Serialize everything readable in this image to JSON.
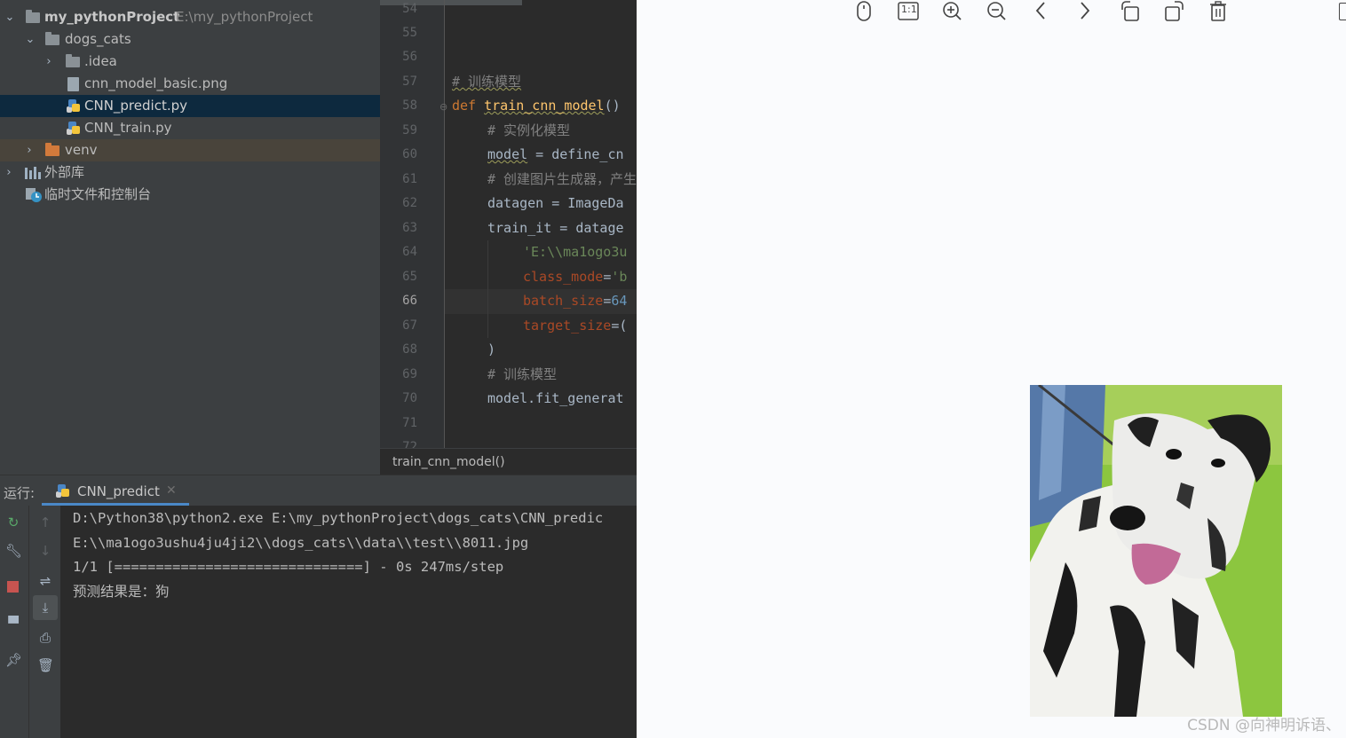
{
  "project": {
    "root_name": "my_pythonProject",
    "root_path": "E:\\my_pythonProject",
    "items": [
      {
        "label": "dogs_cats"
      },
      {
        "label": ".idea"
      },
      {
        "label": "cnn_model_basic.png"
      },
      {
        "label": "CNN_predict.py"
      },
      {
        "label": "CNN_train.py"
      },
      {
        "label": "venv"
      }
    ],
    "external_libs": "外部库",
    "scratches": "临时文件和控制台"
  },
  "editor": {
    "line_numbers": [
      "54",
      "55",
      "56",
      "57",
      "58",
      "59",
      "60",
      "61",
      "62",
      "63",
      "64",
      "65",
      "66",
      "67",
      "68",
      "69",
      "70",
      "71",
      "72"
    ],
    "current_line": "66",
    "code": {
      "l57": "# 训练模型",
      "l58_kw": "def",
      "l58_fn": "train_cnn_model",
      "l58_tail": "()",
      "l59": "# 实例化模型",
      "l60_var": "model",
      "l60_rest": " = define_cn",
      "l61": "# 创建图片生成器，产生",
      "l62": "datagen = ImageDa",
      "l63": "train_it = datage",
      "l64": "'E:\\\\ma1ogo3u",
      "l65_p": "class_mode",
      "l65_s": "'b",
      "l66_p": "batch_size",
      "l66_n": "64",
      "l67_p": "target_size",
      "l67_s": "(",
      "l68": ")",
      "l69": "# 训练模型",
      "l70": "model.fit_generat"
    },
    "breadcrumb": "train_cnn_model()"
  },
  "run": {
    "label": "运行:",
    "tab": "CNN_predict",
    "console": [
      "D:\\Python38\\python2.exe E:\\my_pythonProject\\dogs_cats\\CNN_predic",
      "E:\\\\ma1ogo3ushu4ju4ji2\\\\dogs_cats\\\\data\\\\test\\\\8011.jpg",
      "1/1 [==============================] - 0s 247ms/step",
      "预测结果是：狗"
    ]
  },
  "viewer": {
    "toolbar": [
      "mouse-icon",
      "actual-size-icon",
      "zoom-in-icon",
      "zoom-out-icon",
      "previous-icon",
      "next-icon",
      "rotate-left-icon",
      "rotate-right-icon",
      "delete-icon"
    ],
    "actual_size_label": "1:1",
    "watermark": "CSDN @向神明诉语、"
  }
}
